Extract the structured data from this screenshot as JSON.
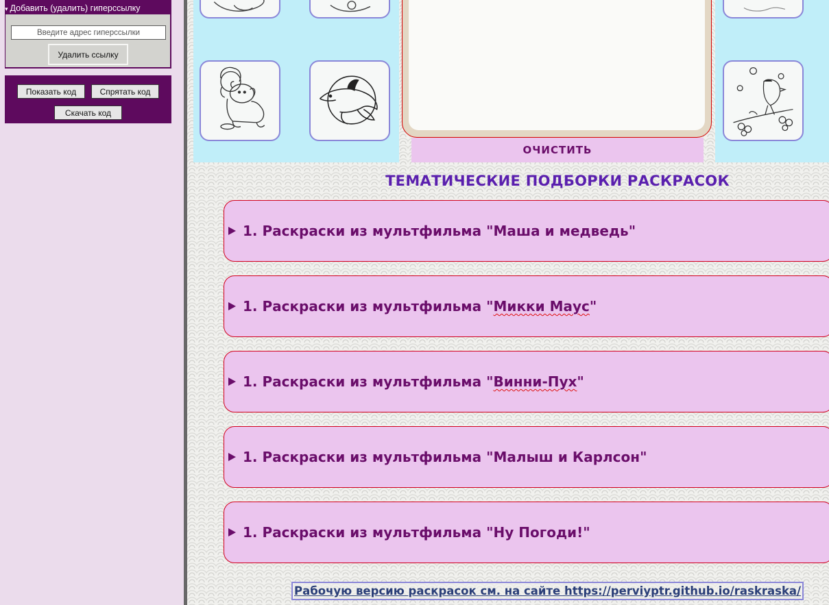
{
  "editor": {
    "hyperlink": {
      "summary_marker": "▾",
      "summary": "Добавить (удалить) гиперссылку",
      "input_value": "",
      "input_placeholder": "Введите адрес гиперссылки",
      "delete_label": "Удалить ссылку"
    },
    "code": {
      "show_label": "Показать код",
      "hide_label": "Спрятать код",
      "download_label": "Скачать код"
    }
  },
  "gallery": {
    "left_thumbnails": [
      "child-with-puppy-icon",
      "dolphin-icon"
    ],
    "right_thumbnails": [
      "bullfinch-on-branch-icon"
    ],
    "clear_label": "ОЧИСТИТЬ"
  },
  "collections": {
    "title": "ТЕМАТИЧЕСКИЕ ПОДБОРКИ РАСКРАСОК",
    "items": [
      {
        "prefix": "1. Раскраски из мультфильма \"",
        "name": "Маша и медведь",
        "suffix": "\""
      },
      {
        "prefix": "1. Раскраски из мультфильма \"",
        "name": "Микки Маус",
        "suffix": "\""
      },
      {
        "prefix": "1. Раскраски из мультфильма \"",
        "name": "Винни-Пух",
        "suffix": "\""
      },
      {
        "prefix": "1. Раскраски из мультфильма \"",
        "name": "Малыш и Карлсон",
        "suffix": "\""
      },
      {
        "prefix": "1. Раскраски из мультфильма \"",
        "name": "Ну Погоди!",
        "suffix": "\""
      }
    ]
  },
  "footer": {
    "link_text": "Рабочую версию раскрасок см. на сайте https://perviyptr.github.io/raskraska/"
  },
  "colors": {
    "panel": "#5e0a5e",
    "accordion_bg": "#ebc5ee",
    "accordion_text": "#6a0d6a",
    "title": "#5a1fae",
    "thumb_bg": "#c0eef9"
  }
}
